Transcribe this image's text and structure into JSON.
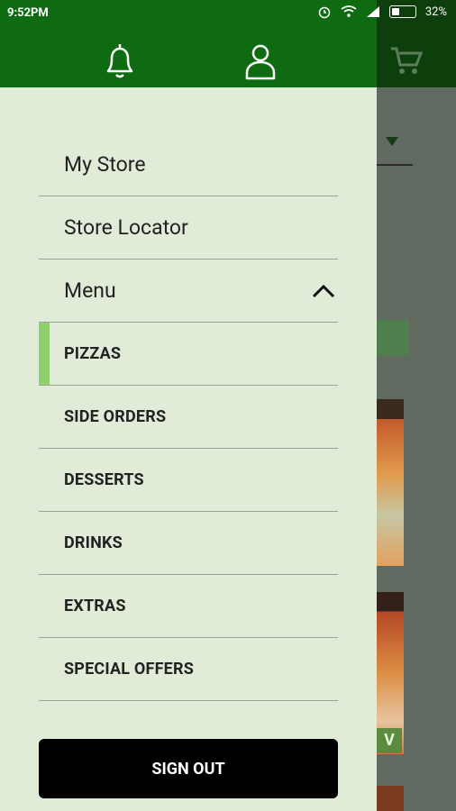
{
  "status_bar": {
    "time": "9:52PM",
    "battery_text": "32%",
    "icons": [
      "alarm-icon",
      "wifi-icon",
      "signal-icon",
      "battery-icon"
    ]
  },
  "drawer": {
    "header_icons": [
      "bell-icon",
      "user-icon"
    ],
    "items": [
      {
        "label": "My Store"
      },
      {
        "label": "Store Locator"
      },
      {
        "label": "Menu",
        "expanded": true
      }
    ],
    "submenu": [
      {
        "label": "PIZZAS",
        "active": true
      },
      {
        "label": "SIDE ORDERS"
      },
      {
        "label": "DESSERTS"
      },
      {
        "label": "DRINKS"
      },
      {
        "label": "EXTRAS"
      },
      {
        "label": "SPECIAL OFFERS"
      }
    ],
    "signout_label": "SIGN OUT"
  },
  "colors": {
    "header_green": "#0f6b12",
    "drawer_bg": "#e1ecd8",
    "active_indicator": "#8fcf6d",
    "signout_bg": "#000000"
  },
  "background": {
    "tag_letter": "V",
    "cart_icon": "cart-icon"
  }
}
